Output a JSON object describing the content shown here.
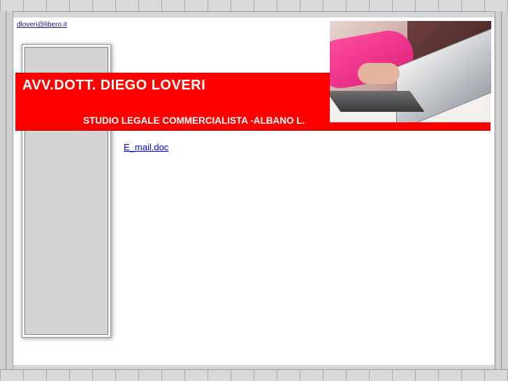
{
  "header": {
    "email_link": "dloveri@libero.it"
  },
  "banner": {
    "title": "AVV.DOTT. DIEGO LOVERI",
    "subtitle": "STUDIO LEGALE COMMERCIALISTA -ALBANO L.",
    "color": "#ff0000"
  },
  "content": {
    "document_link": "E_mail.doc"
  }
}
